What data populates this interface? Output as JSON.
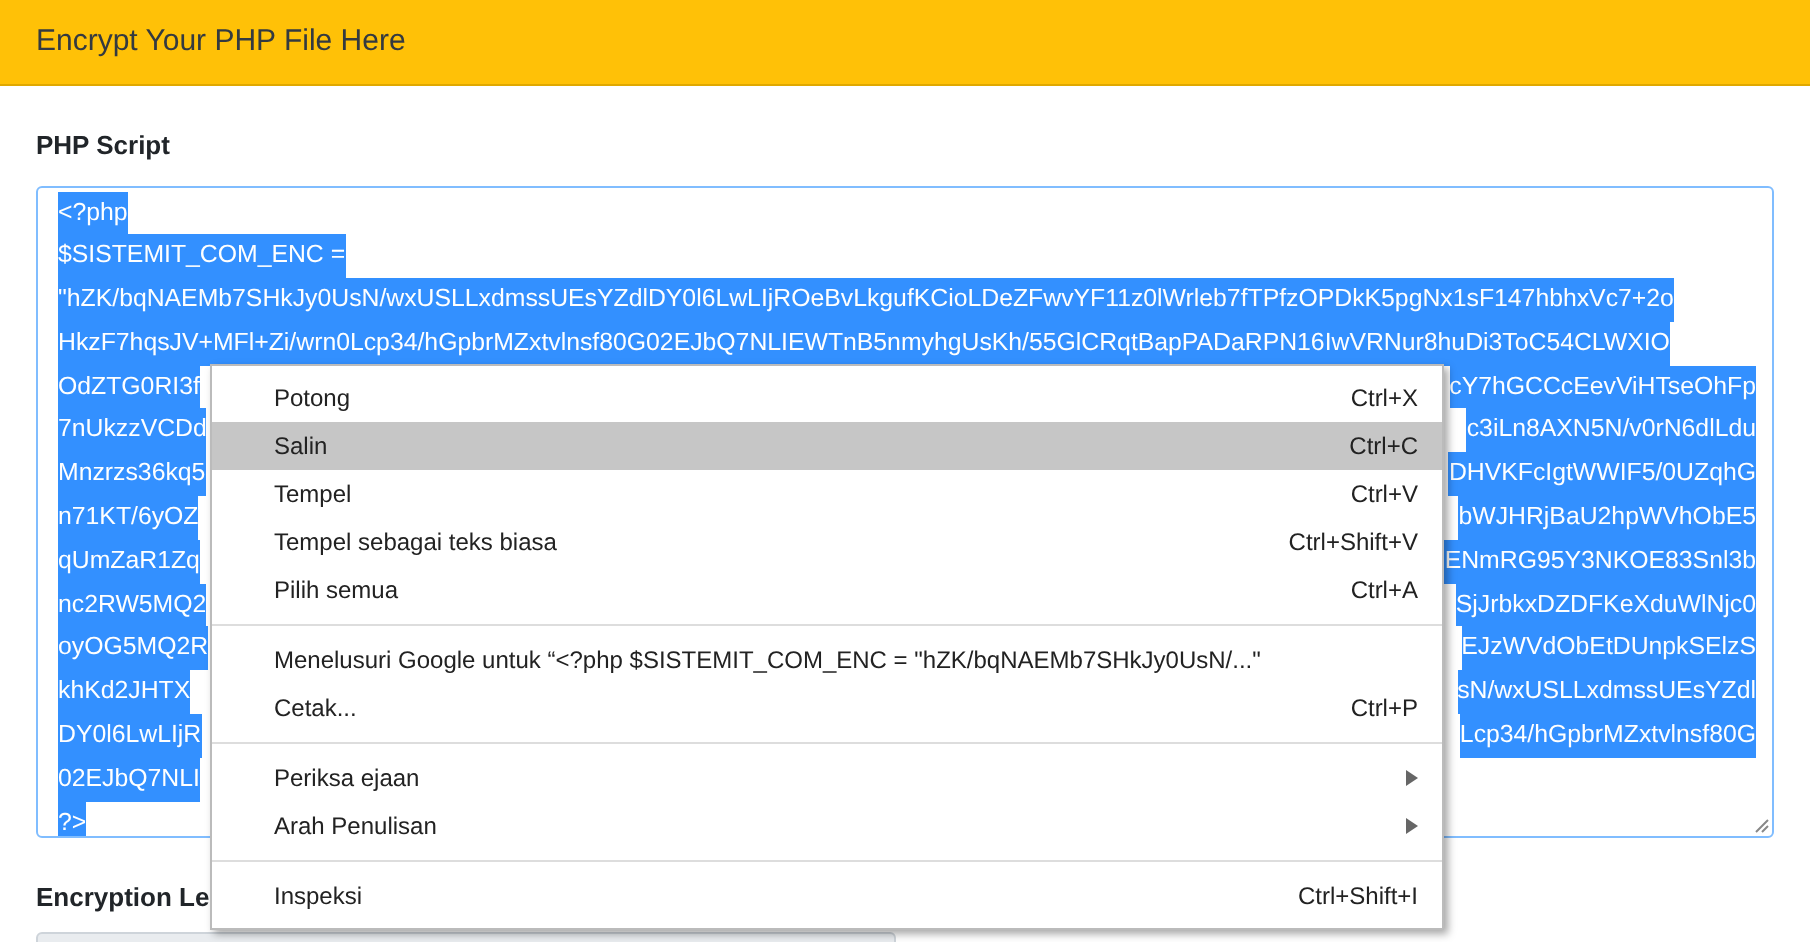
{
  "header": {
    "title": "Encrypt Your PHP File Here"
  },
  "script": {
    "label": "PHP Script",
    "lines": [
      {
        "left": "<?php"
      },
      {
        "left": "$SISTEMIT_COM_ENC ="
      },
      {
        "left": "\"hZK/bqNAEMb7SHkJy0UsN/wxUSLLxdmssUEsYZdlDY0l6LwLIjROeBvLkgufKCioLDeZFwvYF11z0lWrleb7fTPfzOPDkK5pgNx1sF147hbhxVc7+2o"
      },
      {
        "left": "HkzF7hqsJV+MFl+Zi/wrn0Lcp34/hGpbrMZxtvlnsf80G02EJbQ7NLIEWTnB5nmyhgUsKh/55GlCRqtBapPADaRPN16IwVRNur8huDi3ToC54CLWXIO"
      },
      {
        "left": "OdZTG0RI3f",
        "right": "cY7hGCCcEevViHTseOhFp"
      },
      {
        "left": "7nUkzzVCDd",
        "right": "c3iLn8AXN5N/v0rN6dlLdu"
      },
      {
        "left": "Mnzrzs36kq5",
        "right": "DHVKFcIgtWWIF5/0UZqhG"
      },
      {
        "left": "n71KT/6yOZ",
        "right": "bWJHRjBaU2hpWVhObE5"
      },
      {
        "left": "qUmZaR1Zq",
        "right": "ENmRG95Y3NKOE83Snl3b"
      },
      {
        "left": "nc2RW5MQ2",
        "right": "SjJrbkxDZDFKeXduWlNjc0"
      },
      {
        "left": "oyOG5MQ2R",
        "right": "EJzWVdObEtDUnpkSElzS"
      },
      {
        "left": "khKd2JHTX",
        "right": "sN/wxUSLLxdmssUEsYZdl"
      },
      {
        "left": "DY0l6LwLIjR",
        "right": "Lcp34/hGpbrMZxtvlnsf80G"
      },
      {
        "left": "02EJbQ7NLI"
      },
      {
        "left": "?>"
      }
    ]
  },
  "level": {
    "label": "Encryption Le"
  },
  "context_menu": {
    "groups": [
      [
        {
          "label": "Potong",
          "shortcut": "Ctrl+X",
          "selected": false
        },
        {
          "label": "Salin",
          "shortcut": "Ctrl+C",
          "selected": true
        },
        {
          "label": "Tempel",
          "shortcut": "Ctrl+V",
          "selected": false
        },
        {
          "label": "Tempel sebagai teks biasa",
          "shortcut": "Ctrl+Shift+V",
          "selected": false
        },
        {
          "label": "Pilih semua",
          "shortcut": "Ctrl+A",
          "selected": false
        }
      ],
      [
        {
          "label": "Menelusuri Google untuk “<?php $SISTEMIT_COM_ENC = \"hZK/bqNAEMb7SHkJy0UsN/...\"",
          "selected": false
        },
        {
          "label": "Cetak...",
          "shortcut": "Ctrl+P",
          "selected": false
        }
      ],
      [
        {
          "label": "Periksa ejaan",
          "submenu": true,
          "selected": false
        },
        {
          "label": "Arah Penulisan",
          "submenu": true,
          "selected": false
        }
      ],
      [
        {
          "label": "Inspeksi",
          "shortcut": "Ctrl+Shift+I",
          "selected": false
        }
      ]
    ]
  }
}
